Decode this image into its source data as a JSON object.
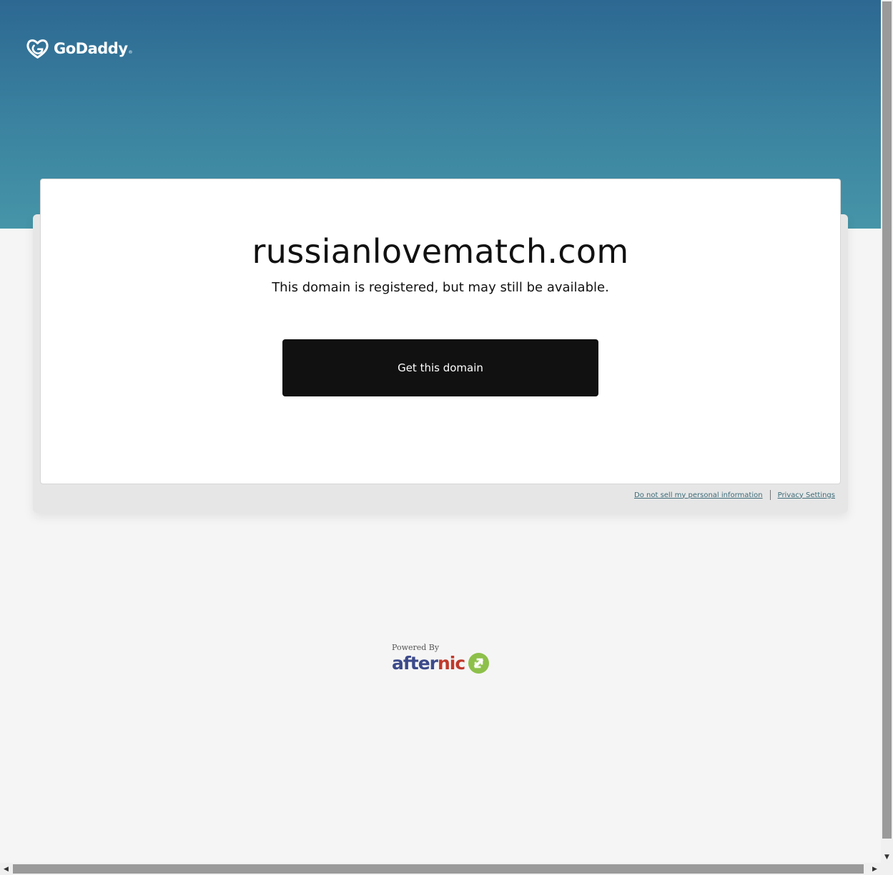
{
  "header": {
    "logo_text": "GoDaddy",
    "logo_tm": "®"
  },
  "card": {
    "domain": "russianlovematch.com",
    "subtitle": "This domain is registered, but may still be available.",
    "cta_label": "Get this domain"
  },
  "footer": {
    "links": [
      {
        "label": "Do not sell my personal information"
      },
      {
        "label": "Privacy Settings"
      }
    ]
  },
  "powered": {
    "label": "Powered By",
    "brand_after": "after",
    "brand_nic": "nic"
  },
  "scrollbars": {
    "up_arrow": "▲",
    "down_arrow": "▼",
    "left_arrow": "◀",
    "right_arrow": "▶"
  },
  "colors": {
    "hero_top": "#2d6892",
    "hero_bottom": "#4695a8",
    "cta_bg": "#111111",
    "link": "#3c6b78",
    "afternic_blue": "#3c4a8a",
    "afternic_red": "#c0392b",
    "afternic_green": "#8dc04a"
  }
}
